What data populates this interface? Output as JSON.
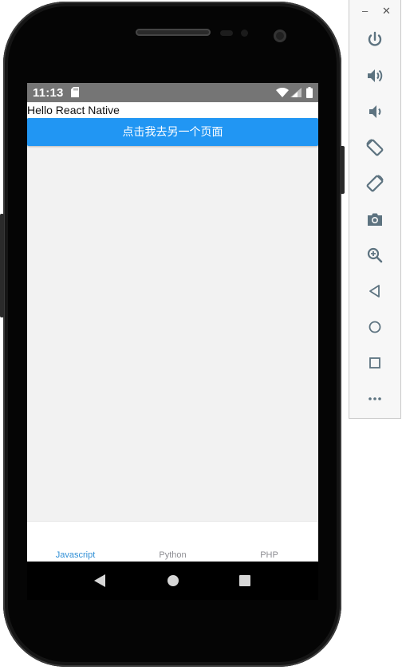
{
  "statusbar": {
    "time": "11:13"
  },
  "app": {
    "greeting": "Hello React Native",
    "primary_button_label": "点击我去另一个页面"
  },
  "tabs": [
    {
      "label": "Javascript",
      "active": true
    },
    {
      "label": "Python",
      "active": false
    },
    {
      "label": "PHP",
      "active": false
    }
  ],
  "colors": {
    "accent": "#2196f3",
    "tab_active": "#2f8fd6",
    "tab_inactive": "#8e8e93",
    "statusbar": "#757575",
    "toolbar_icon": "#5d7380"
  },
  "emulator_panel": {
    "window_controls": [
      "minimize-icon",
      "close-icon"
    ],
    "tools": [
      "power-icon",
      "volume-up-icon",
      "volume-down-icon",
      "rotate-left-icon",
      "rotate-right-icon",
      "camera-icon",
      "zoom-icon",
      "back-icon",
      "home-icon",
      "overview-icon",
      "more-icon"
    ]
  },
  "navbar": {
    "buttons": [
      "back-icon",
      "home-icon",
      "recents-icon"
    ]
  }
}
